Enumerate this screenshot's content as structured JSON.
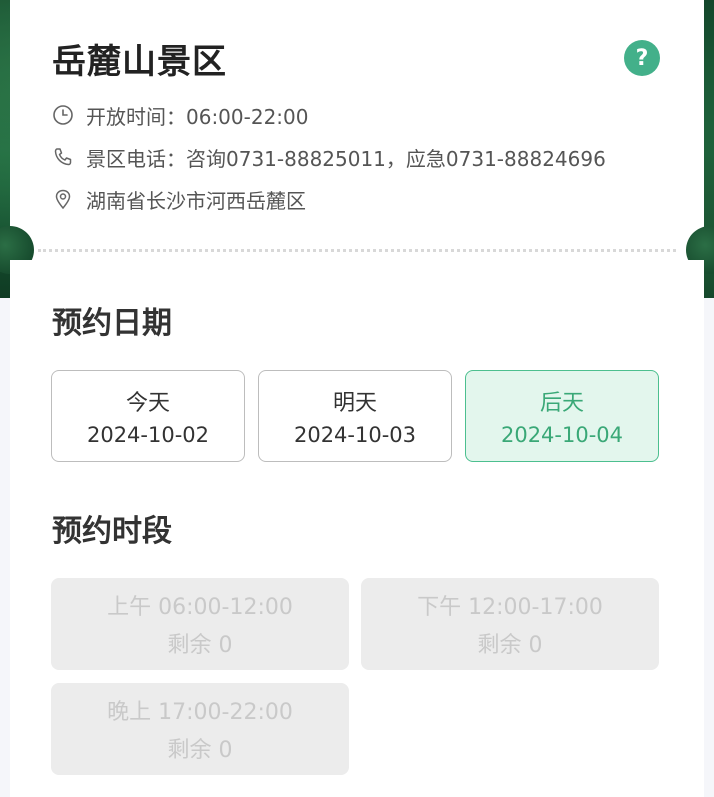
{
  "scenic": {
    "title": "岳麓山景区",
    "help_icon": "?",
    "hours": "开放时间：06:00-22:00",
    "phone": "景区电话：咨询0731-88825011，应急0731-88824696",
    "address": "湖南省长沙市河西岳麓区"
  },
  "booking": {
    "date_title": "预约日期",
    "time_title": "预约时段",
    "dates": [
      {
        "label": "今天",
        "date": "2024-10-02",
        "selected": false
      },
      {
        "label": "明天",
        "date": "2024-10-03",
        "selected": false
      },
      {
        "label": "后天",
        "date": "2024-10-04",
        "selected": true
      }
    ],
    "slots": [
      {
        "time": "上午 06:00-12:00",
        "remain": "剩余 0"
      },
      {
        "time": "下午 12:00-17:00",
        "remain": "剩余 0"
      },
      {
        "time": "晚上 17:00-22:00",
        "remain": "剩余 0"
      }
    ]
  },
  "colors": {
    "accent": "#43b08a",
    "selected_bg": "#e3f6ed",
    "disabled_bg": "#ececec"
  },
  "icons": [
    "clock-icon",
    "phone-icon",
    "location-pin-icon",
    "help-icon"
  ]
}
